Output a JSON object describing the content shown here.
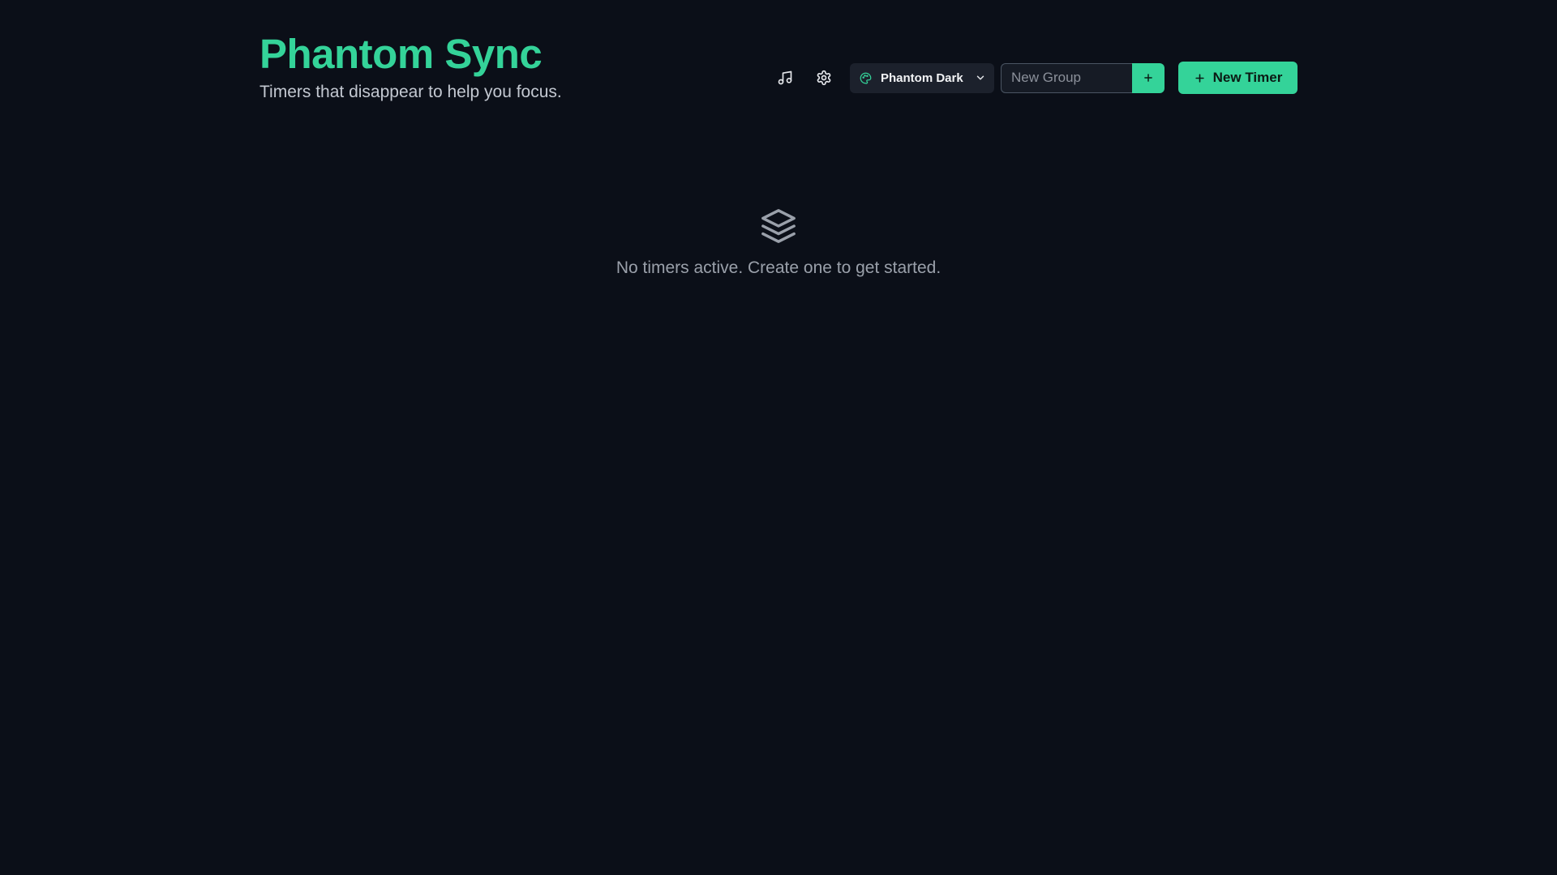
{
  "app": {
    "title": "Phantom Sync",
    "subtitle": "Timers that disappear to help you focus."
  },
  "toolbar": {
    "music_icon": "music-note-icon",
    "settings_icon": "gear-icon",
    "theme": {
      "icon": "palette-icon",
      "selected": "Phantom Dark",
      "chevron_icon": "chevron-down-icon"
    },
    "group_input": {
      "placeholder": "New Group",
      "value": ""
    },
    "add_group_icon": "plus-icon",
    "new_timer_label": "New Timer",
    "new_timer_icon": "plus-icon"
  },
  "empty_state": {
    "icon": "layers-icon",
    "message": "No timers active. Create one to get started."
  },
  "colors": {
    "background": "#0b0f18",
    "accent": "#34d399",
    "subtitle": "#c3c8d1",
    "muted": "#9aa0aa",
    "select_bg": "#1c212c"
  }
}
